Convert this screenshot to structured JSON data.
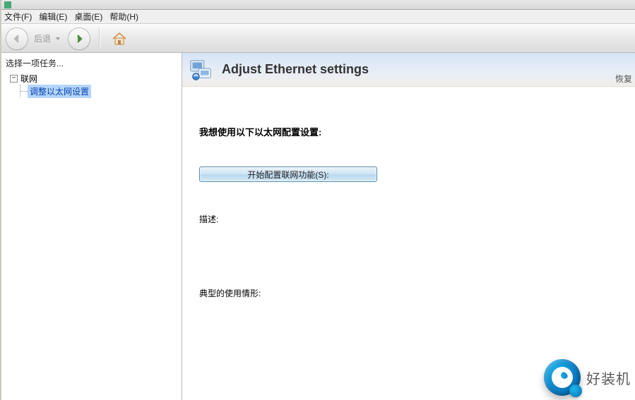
{
  "titlebar": {
    "text": ""
  },
  "menu": {
    "file": "文件(F)",
    "edit": "编辑(E)",
    "desktop": "桌面(E)",
    "help": "帮助(H)"
  },
  "toolbar": {
    "back_label": "后退",
    "back_icon": "arrow-left",
    "forward_icon": "arrow-right",
    "home_icon": "home"
  },
  "sidebar": {
    "task_label": "选择一项任务...",
    "root": {
      "label": "联网",
      "expanded": true
    },
    "child": {
      "label": "调整以太网设置",
      "selected": true
    }
  },
  "header": {
    "title": "Adjust Ethernet settings",
    "restore": "恢复"
  },
  "main": {
    "intro": "我想使用以下以太网配置设置:",
    "button": "开始配置联网功能(S):",
    "description_label": "描述:",
    "typical_label": "典型的使用情形:"
  },
  "watermark": {
    "text": "好装机"
  }
}
